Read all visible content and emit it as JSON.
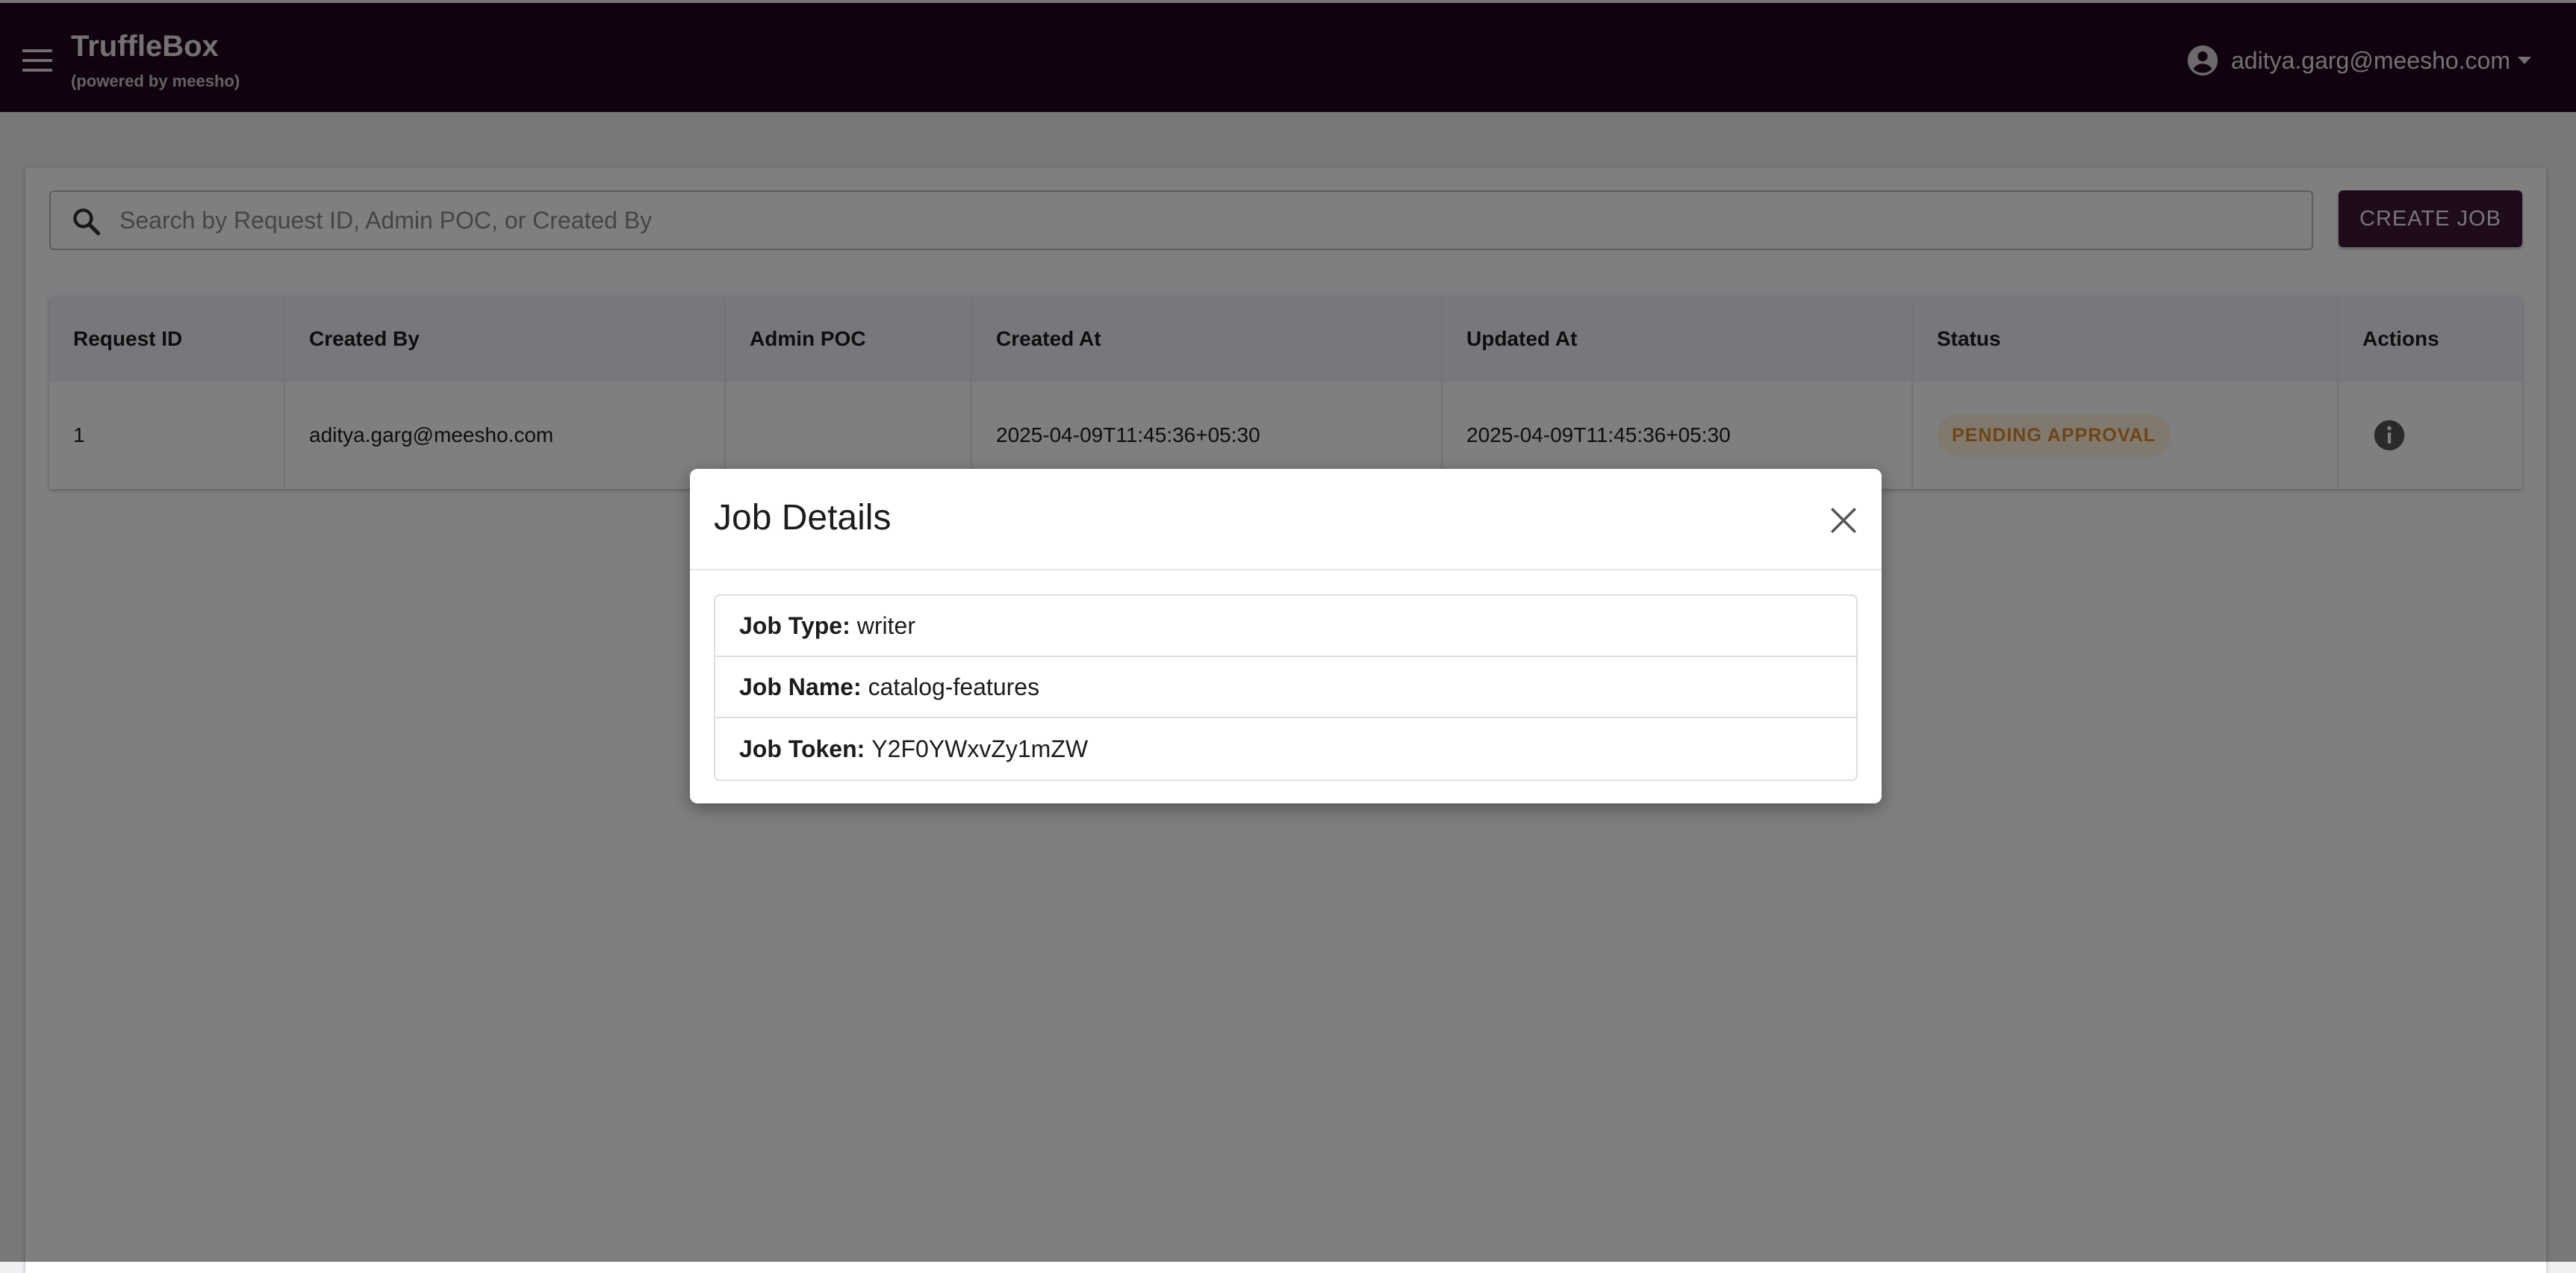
{
  "app": {
    "title": "TruffleBox",
    "subtitle": "(powered by meesho)",
    "menu_icon": "menu-icon"
  },
  "user": {
    "email": "aditya.garg@meesho.com",
    "icon": "account-circle-icon"
  },
  "search": {
    "placeholder": "Search by Request ID, Admin POC, or Created By",
    "value": ""
  },
  "toolbar": {
    "create_job_label": "CREATE JOB"
  },
  "table": {
    "columns": [
      "Request ID",
      "Created By",
      "Admin POC",
      "Created At",
      "Updated At",
      "Status",
      "Actions"
    ],
    "rows": [
      {
        "request_id": "1",
        "created_by": "aditya.garg@meesho.com",
        "admin_poc": "",
        "created_at": "2025-04-09T11:45:36+05:30",
        "updated_at": "2025-04-09T11:45:36+05:30",
        "status": "PENDING APPROVAL",
        "action_icon": "info-icon"
      }
    ]
  },
  "modal": {
    "title": "Job Details",
    "items": [
      {
        "label": "Job Type:",
        "value": "writer"
      },
      {
        "label": "Job Name:",
        "value": "catalog-features"
      },
      {
        "label": "Job Token:",
        "value": "Y2F0YWxvZy1mZW"
      }
    ]
  },
  "colors": {
    "appbar_bg": "#21061f",
    "primary_button": "#3c1638",
    "status_pending_text": "#e0892a",
    "status_pending_bg": "#fff3dc"
  }
}
